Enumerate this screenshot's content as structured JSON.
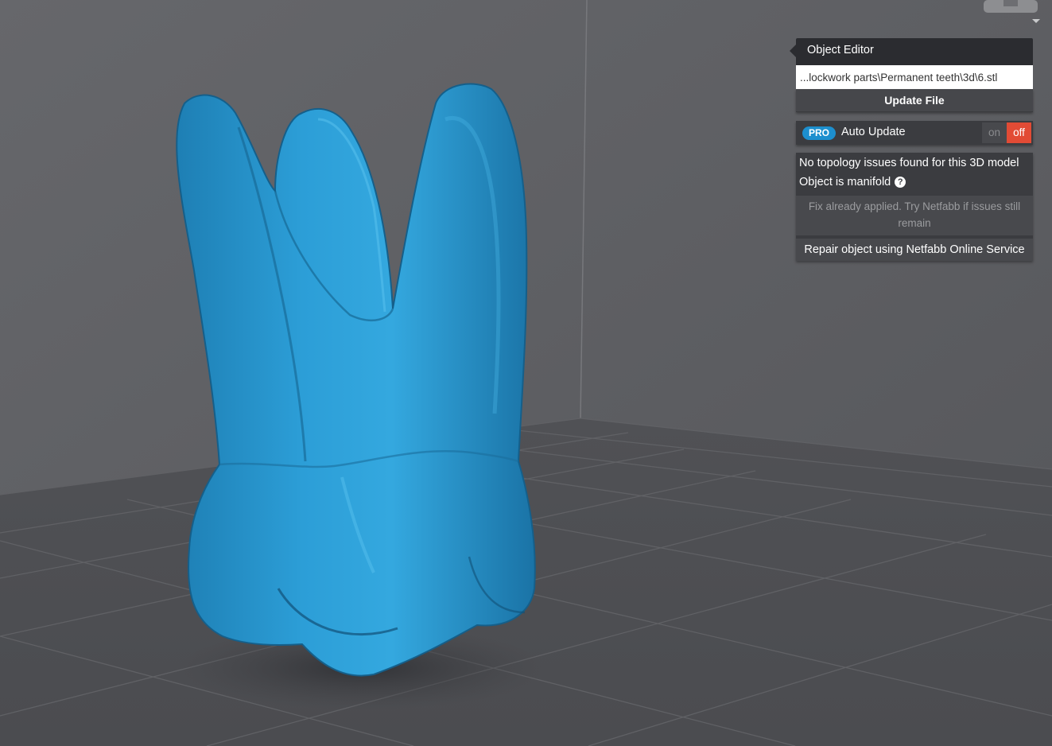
{
  "colors": {
    "background": "#5a5b5f",
    "model": "#2b9ad3",
    "accent_pro": "#1d8fce",
    "toggle_off": "#e24b35"
  },
  "object_editor": {
    "title": "Object Editor",
    "file_path": "...lockwork parts\\Permanent teeth\\3d\\6.stl",
    "update_button": "Update File"
  },
  "auto_update": {
    "badge": "PRO",
    "label": "Auto Update",
    "on_label": "on",
    "off_label": "off",
    "state": "off"
  },
  "topology": {
    "status": "No topology issues found for this 3D model",
    "manifold": "Object is manifold",
    "help_icon": "question-circle-icon",
    "fix_note": "Fix already applied. Try Netfabb if issues still remain",
    "repair_button": "Repair object using Netfabb Online Service"
  }
}
